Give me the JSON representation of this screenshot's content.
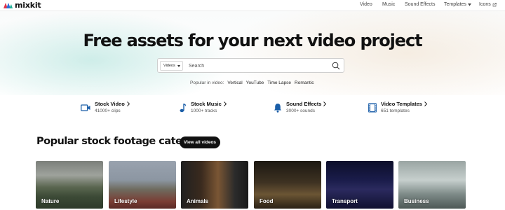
{
  "brand": {
    "name": "mixkit"
  },
  "nav": {
    "video": "Video",
    "music": "Music",
    "sound_effects": "Sound Effects",
    "templates": "Templates",
    "icons": "Icons"
  },
  "hero": {
    "title": "Free assets for your next video project",
    "search": {
      "type_selected": "Videos",
      "placeholder": "Search",
      "value": ""
    },
    "popular_label": "Popular in video:",
    "popular_keywords": [
      "Vertical",
      "YouTube",
      "Time Lapse",
      "Romantic"
    ]
  },
  "asset_types": [
    {
      "name": "Stock Video",
      "count": "41000+ clips",
      "icon": "video-camera-icon"
    },
    {
      "name": "Stock Music",
      "count": "1000+ tracks",
      "icon": "music-note-icon"
    },
    {
      "name": "Sound Effects",
      "count": "3000+ sounds",
      "icon": "bell-icon"
    },
    {
      "name": "Video Templates",
      "count": "651 templates",
      "icon": "film-strip-icon"
    }
  ],
  "categories_section": {
    "title": "Popular stock footage categories",
    "view_all": "View all videos",
    "cards": [
      "Nature",
      "Lifestyle",
      "Animals",
      "Food",
      "Transport",
      "Business"
    ]
  },
  "colors": {
    "accent_blue": "#1a5ea8",
    "brand_red": "#e2364b",
    "button_dark": "#111111"
  }
}
